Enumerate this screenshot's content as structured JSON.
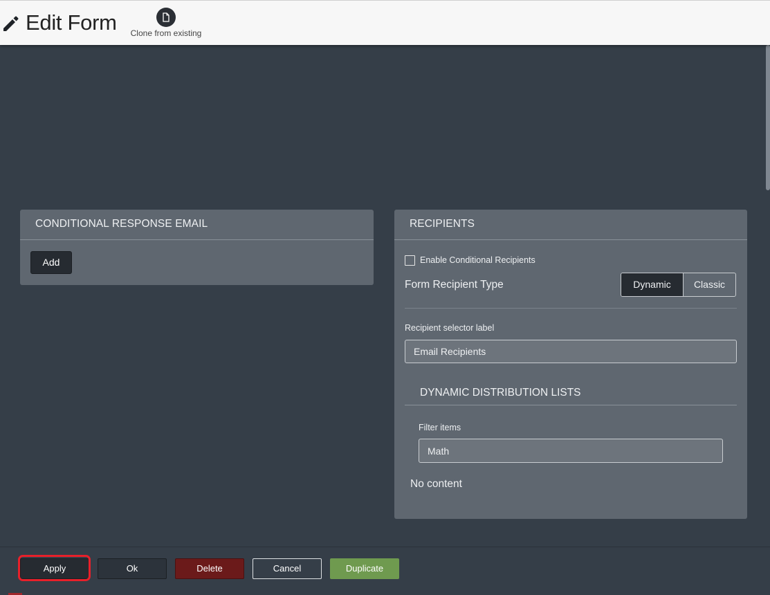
{
  "header": {
    "title": "Edit Form",
    "clone_label": "Clone from existing"
  },
  "conditional_email": {
    "title": "CONDITIONAL RESPONSE EMAIL",
    "add_label": "Add"
  },
  "recipients": {
    "title": "RECIPIENTS",
    "enable_conditional_label": "Enable Conditional Recipients",
    "enable_conditional_checked": false,
    "recipient_type_label": "Form Recipient Type",
    "type_options": [
      "Dynamic",
      "Classic"
    ],
    "type_selected": "Dynamic",
    "selector_label": "Recipient selector label",
    "selector_value": "Email Recipients",
    "dynamic_lists_title": "DYNAMIC DISTRIBUTION LISTS",
    "filter_label": "Filter items",
    "filter_value": "Math",
    "no_content": "No content"
  },
  "footer": {
    "apply": "Apply",
    "ok": "Ok",
    "delete": "Delete",
    "cancel": "Cancel",
    "duplicate": "Duplicate"
  },
  "colors": {
    "background": "#353e48",
    "panel": "#5f6770",
    "dark_button": "#262b31",
    "delete": "#6b1a1a",
    "duplicate": "#6f9a4f",
    "highlight": "#e8202a"
  }
}
